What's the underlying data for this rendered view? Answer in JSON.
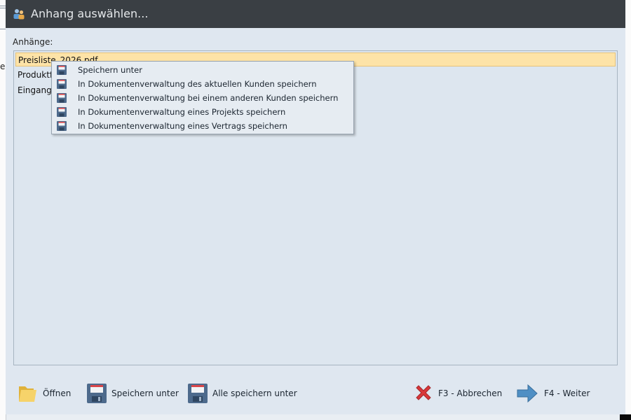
{
  "background_app": {
    "partial_char": "e"
  },
  "dialog": {
    "title": "Anhang auswählen...",
    "attachments_label": "Anhänge:",
    "attachments": [
      {
        "name": "Preisliste_2026.pdf",
        "selected": true
      },
      {
        "name": "Produktfo",
        "selected": false
      },
      {
        "name": "Eingangs",
        "selected": false
      }
    ]
  },
  "context_menu": {
    "items": [
      {
        "label": "Speichern unter",
        "icon": "floppy-disk-icon"
      },
      {
        "label": "In Dokumentenverwaltung des aktuellen Kunden speichern",
        "icon": "floppy-disk-icon"
      },
      {
        "label": "In Dokumentenverwaltung bei einem anderen Kunden speichern",
        "icon": "floppy-disk-icon"
      },
      {
        "label": "In Dokumentenverwaltung eines Projekts speichern",
        "icon": "floppy-disk-icon"
      },
      {
        "label": "In Dokumentenverwaltung eines Vertrags speichern",
        "icon": "floppy-disk-icon"
      }
    ]
  },
  "footer": {
    "open_label": "Öffnen",
    "save_as_label": "Speichern unter",
    "save_all_label": "Alle speichern unter",
    "cancel_label": "F3 - Abbrechen",
    "next_label": "F4 - Weiter"
  },
  "colors": {
    "titlebar": "#3a3f44",
    "dialog_bg": "#dfe7f0",
    "selection": "#fde3a7",
    "cancel_red": "#d9383a",
    "next_blue": "#4f8fc4"
  }
}
